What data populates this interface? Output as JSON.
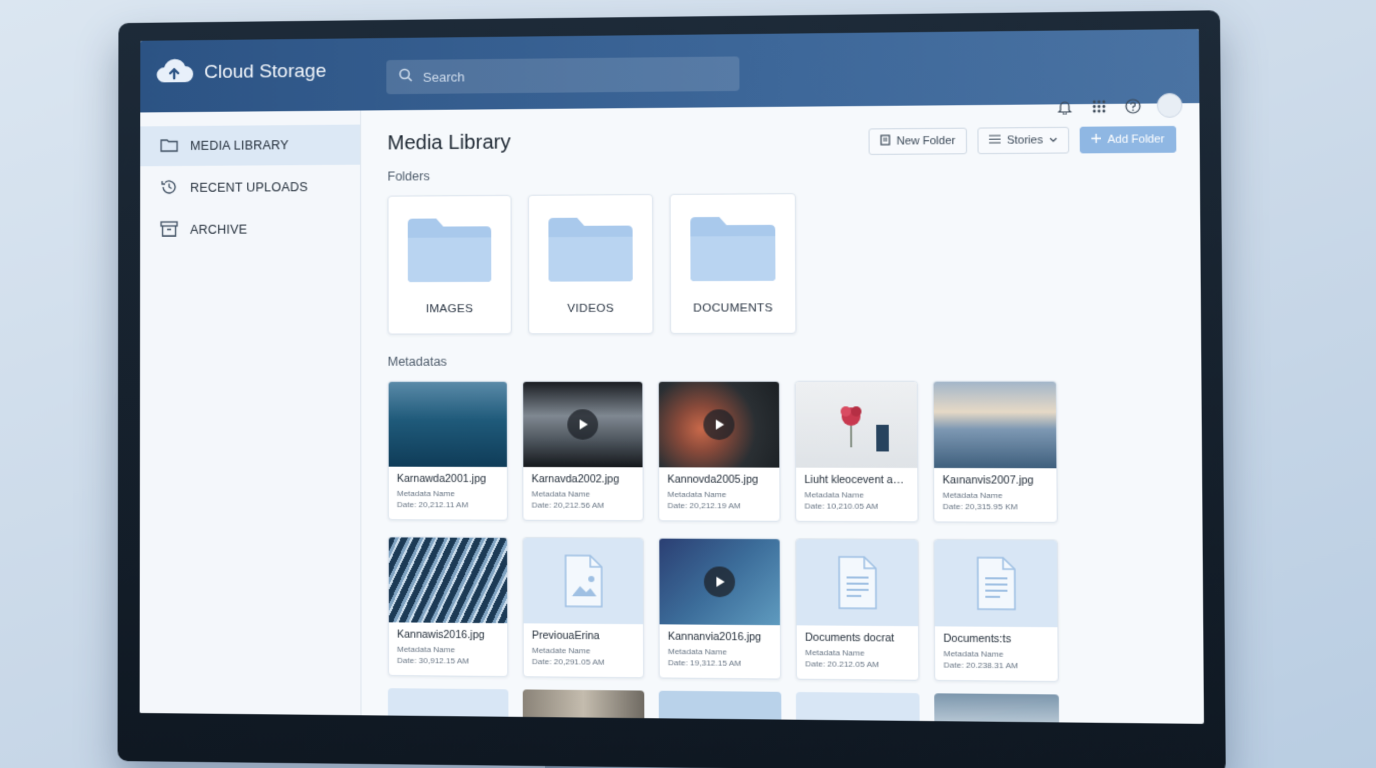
{
  "app": {
    "title": "Cloud Storage"
  },
  "search": {
    "placeholder": "Search"
  },
  "sidebar": {
    "items": [
      {
        "label": "MEDIA LIBRARY",
        "icon": "folder-icon",
        "active": true
      },
      {
        "label": "RECENT UPLOADS",
        "icon": "history-icon",
        "active": false
      },
      {
        "label": "ARCHIVE",
        "icon": "archive-icon",
        "active": false
      }
    ]
  },
  "header_icons": [
    "bell-icon",
    "apps-grid-icon",
    "help-icon",
    "avatar"
  ],
  "main": {
    "title": "Media Library",
    "folders_label": "Folders",
    "metadata_label": "Metadatas",
    "actions": {
      "new_folder": "New Folder",
      "sort": "Stories",
      "add_folder": "Add Folder"
    },
    "folders": [
      {
        "label": "IMAGES"
      },
      {
        "label": "VIDEOS"
      },
      {
        "label": "DOCUMENTS"
      }
    ],
    "media": [
      {
        "name": "Karnawda2001.jpg",
        "meta": "Metadata Name",
        "date": "Date: 20,212.11 AM",
        "kind": "image",
        "thumb": "ocean"
      },
      {
        "name": "Karnavda2002.jpg",
        "meta": "Metadata Name",
        "date": "Date: 20,212.56 AM",
        "kind": "video",
        "thumb": "road"
      },
      {
        "name": "Kannovda2005.jpg",
        "meta": "Metadata Name",
        "date": "Date: 20,212.19 AM",
        "kind": "video",
        "thumb": "hand"
      },
      {
        "name": "Liuht kleocevent and...",
        "meta": "Metadata Name",
        "date": "Date: 10,210.05 AM",
        "kind": "image",
        "thumb": "flower"
      },
      {
        "name": "Kaınanvis2007.jpg",
        "meta": "Metadata Name",
        "date": "Date: 20,315.95 KM",
        "kind": "image",
        "thumb": "ice"
      },
      {
        "name": "Kannawis2016.jpg",
        "meta": "Metadata Name",
        "date": "Date: 30,912.15 AM",
        "kind": "image",
        "thumb": "building"
      },
      {
        "name": "PreviouaErina",
        "meta": "Metadate Name",
        "date": "Date: 20,291.05 AM",
        "kind": "doc-image",
        "thumb": "doc"
      },
      {
        "name": "Kannanvia2016.jpg",
        "meta": "Metadata Name",
        "date": "Date: 19,312.15 AM",
        "kind": "video",
        "thumb": "gradient"
      },
      {
        "name": "Documents docrat",
        "meta": "Metadata Name",
        "date": "Date: 20.212.05 AM",
        "kind": "document",
        "thumb": "doc"
      },
      {
        "name": "Documents:ts",
        "meta": "Metadata Name",
        "date": "Date: 20.238.31 AM",
        "kind": "document",
        "thumb": "doc"
      }
    ]
  },
  "colors": {
    "topbar": "#2c5384",
    "accent": "#8fb7e3",
    "folder": "#a9c9ec",
    "sidebar_active": "#dce8f5"
  }
}
